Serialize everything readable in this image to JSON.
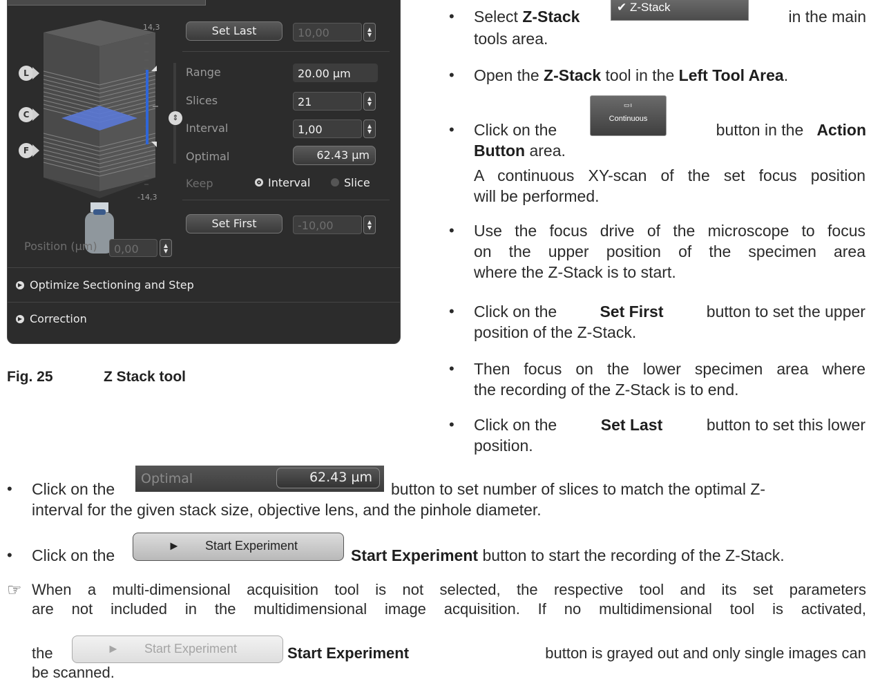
{
  "panel": {
    "set_last_label": "Set Last",
    "set_last_value": "10,00",
    "scale_top": "14,3",
    "scale_bottom": "-14,3",
    "range_label": "Range",
    "range_value": "20.00 µm",
    "slices_label": "Slices",
    "slices_value": "21",
    "interval_label": "Interval",
    "interval_value": "1,00",
    "optimal_label": "Optimal",
    "optimal_value": "62.43 µm",
    "keep_label": "Keep",
    "keep_interval_label": "Interval",
    "keep_slice_label": "Slice",
    "keep_selected": "Interval",
    "set_first_label": "Set First",
    "set_first_value": "-10,00",
    "position_label": "Position (µm)",
    "position_value": "0,00",
    "markers": [
      "L",
      "C",
      "F"
    ],
    "section_optimize": "Optimize Sectioning and Step",
    "section_correction": "Correction",
    "stack_highlight_color": "#5b79d6"
  },
  "figure_caption": {
    "number": "Fig. 25",
    "title": "Z Stack tool"
  },
  "inline_ui": {
    "zstack_checkbox_label": "Z-Stack",
    "continuous_button_label": "Continuous",
    "optimal_label": "Optimal",
    "optimal_value": "62.43 µm",
    "start_experiment_label": "Start Experiment"
  },
  "instructions": {
    "b1": {
      "pre": "Select",
      "bold": "Z-Stack",
      "post": "in the main",
      "cont": "tools area."
    },
    "b2": {
      "pre": "Open the",
      "bold1": "Z-Stack",
      "mid": "tool in the",
      "bold2": "Left Tool Area",
      "post": "."
    },
    "b3": {
      "pre": "Click on the",
      "post": "button in the",
      "bold": "Action",
      "bold2": "Button",
      "post2": "area.",
      "note1": "A continuous XY-scan of the set focus position",
      "note2": "will be performed."
    },
    "b4": {
      "l1": "Use the focus drive of the microscope to focus",
      "l2": "on the upper position of the specimen area",
      "l3": "where the Z-Stack is to start."
    },
    "b5": {
      "pre": "Click on the",
      "bold": "Set First",
      "post": "button to set the upper",
      "l2": "position of the Z-Stack."
    },
    "b6": {
      "l1": "Then focus on the lower specimen area where",
      "l2": "the recording of the Z-Stack is to end."
    },
    "b7": {
      "pre": "Click on the",
      "bold": "Set Last",
      "post": "button to set this lower",
      "l2": "position."
    },
    "b8": {
      "pre": "Click on the",
      "post": "button to set number of slices to match the optimal Z-",
      "l2": "interval for the given stack size, objective lens, and the pinhole diameter."
    },
    "b9": {
      "pre": "Click on the",
      "bold": "Start Experiment",
      "post": "button to start the recording of the Z-Stack."
    },
    "note": {
      "icon": "pointing-hand-icon",
      "l1": "When a multi-dimensional acquisition tool is not selected, the respective tool and its set parameters",
      "l2": "are not included in the multidimensional image acquisition. If no multidimensional tool is activated,",
      "pre3": "the",
      "bold3": "Start Experiment",
      "post3": "button is grayed out and only single images can",
      "l4": "be scanned."
    }
  }
}
